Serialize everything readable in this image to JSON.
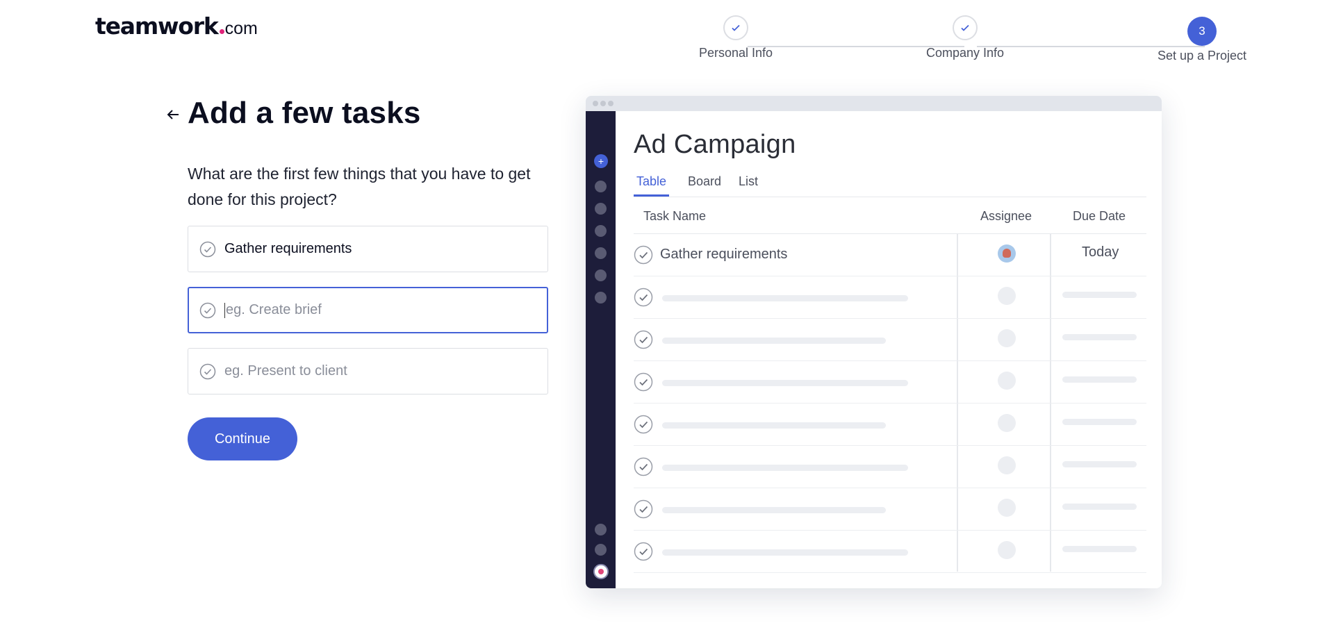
{
  "logo": {
    "word": "teamwork",
    "tld": "com"
  },
  "stepper": {
    "steps": [
      {
        "label": "Personal Info",
        "state": "done"
      },
      {
        "label": "Company Info",
        "state": "done"
      },
      {
        "label": "Set up a Project",
        "state": "active",
        "number": "3"
      }
    ]
  },
  "form": {
    "title": "Add a few tasks",
    "question": "What are the first few things that you have to get done for this project?",
    "inputs": [
      {
        "value": "Gather requirements",
        "placeholder": ""
      },
      {
        "value": "",
        "placeholder": "eg. Create brief"
      },
      {
        "value": "",
        "placeholder": "eg. Present to client"
      }
    ],
    "continue_label": "Continue"
  },
  "preview": {
    "project_title": "Ad Campaign",
    "tabs": [
      "Table",
      "Board",
      "List"
    ],
    "active_tab": "Table",
    "columns": [
      "Task Name",
      "Assignee",
      "Due Date"
    ],
    "first_row": {
      "task": "Gather requirements",
      "due": "Today"
    }
  },
  "colors": {
    "accent": "#4461d7",
    "sidebar": "#1d1d3a",
    "logo_dot": "#e0247a"
  }
}
